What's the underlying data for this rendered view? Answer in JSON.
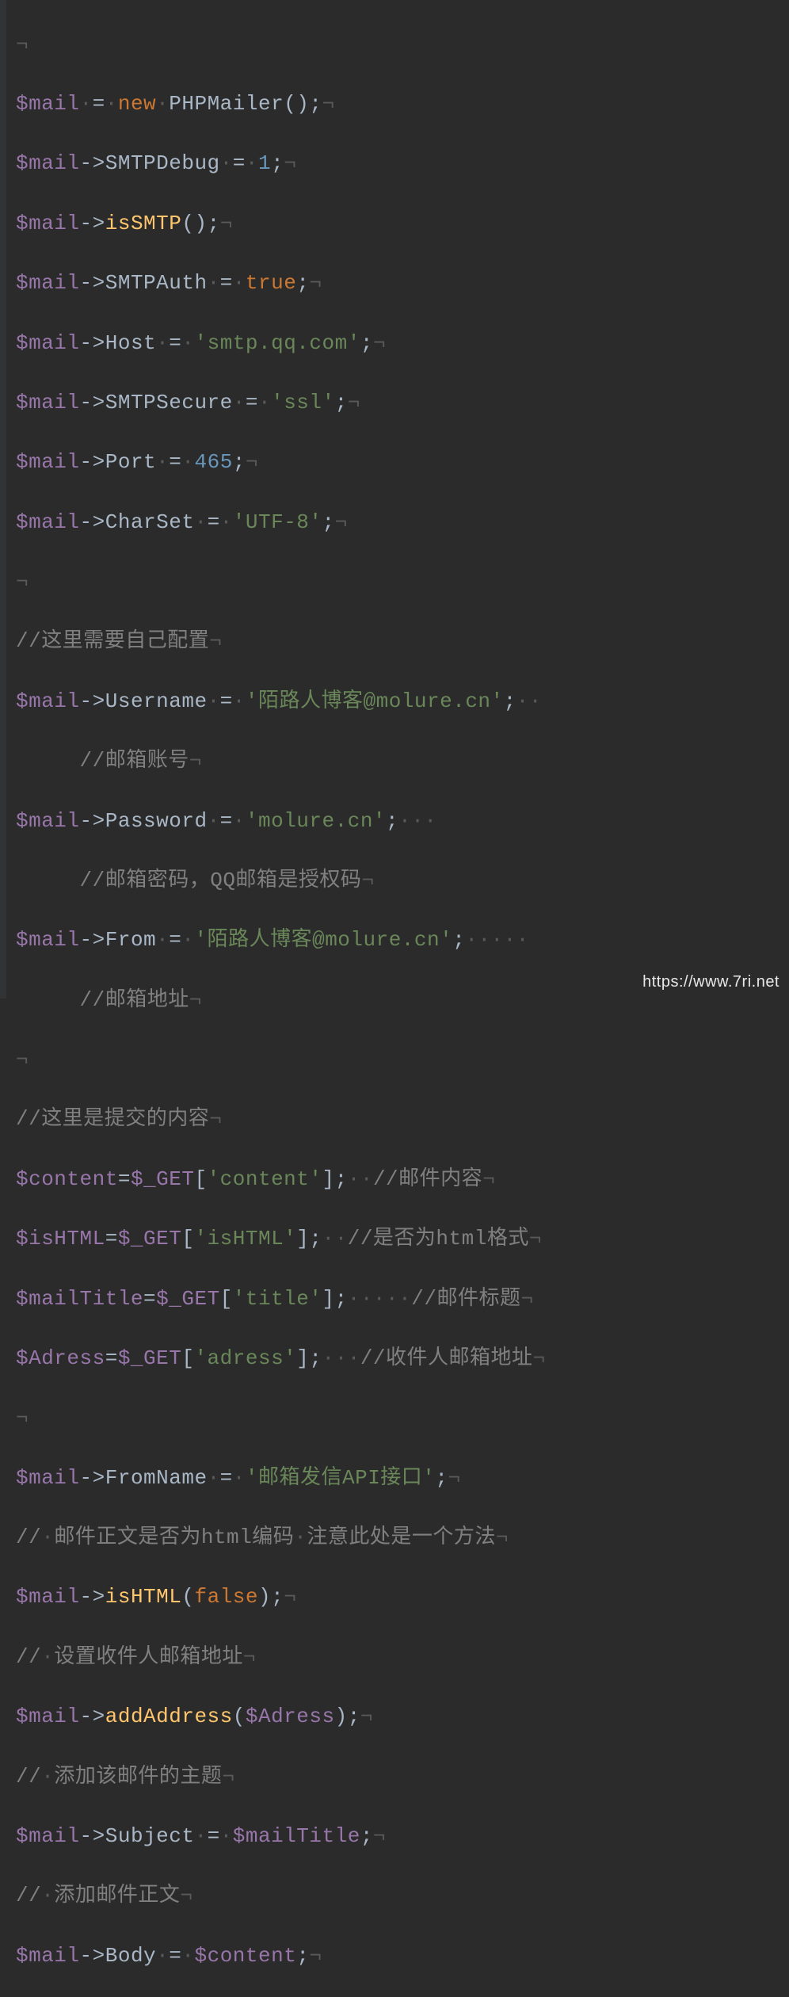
{
  "watermark": "https://www.7ri.net",
  "whitespace": {
    "dot": "·",
    "pilcrow": "¬"
  },
  "code": {
    "l1": {
      "var": "$mail",
      "eq": "=",
      "kw": "new",
      "cls": "PHPMailer",
      "paren": "()",
      "semi": ";"
    },
    "l2": {
      "var": "$mail",
      "arrow": "->",
      "prop": "SMTPDebug",
      "eq": "=",
      "val": "1",
      "semi": ";"
    },
    "l3": {
      "var": "$mail",
      "arrow": "->",
      "func": "isSMTP",
      "paren": "()",
      "semi": ";"
    },
    "l4": {
      "var": "$mail",
      "arrow": "->",
      "prop": "SMTPAuth",
      "eq": "=",
      "val": "true",
      "semi": ";"
    },
    "l5": {
      "var": "$mail",
      "arrow": "->",
      "prop": "Host",
      "eq": "=",
      "str": "'smtp.qq.com'",
      "semi": ";"
    },
    "l6": {
      "var": "$mail",
      "arrow": "->",
      "prop": "SMTPSecure",
      "eq": "=",
      "str": "'ssl'",
      "semi": ";"
    },
    "l7": {
      "var": "$mail",
      "arrow": "->",
      "prop": "Port",
      "eq": "=",
      "val": "465",
      "semi": ";"
    },
    "l8": {
      "var": "$mail",
      "arrow": "->",
      "prop": "CharSet",
      "eq": "=",
      "str": "'UTF-8'",
      "semi": ";"
    },
    "l10": {
      "cmt": "//这里需要自己配置"
    },
    "l11": {
      "var": "$mail",
      "arrow": "->",
      "prop": "Username",
      "eq": "=",
      "str": "'陌路人博客@molure.cn'",
      "semi": ";"
    },
    "l11b": {
      "cmt": "//邮箱账号"
    },
    "l12": {
      "var": "$mail",
      "arrow": "->",
      "prop": "Password",
      "eq": "=",
      "str": "'molure.cn'",
      "semi": ";"
    },
    "l12b": {
      "cmt": "//邮箱密码，QQ邮箱是授权码"
    },
    "l13": {
      "var": "$mail",
      "arrow": "->",
      "prop": "From",
      "eq": "=",
      "str": "'陌路人博客@molure.cn'",
      "semi": ";"
    },
    "l13b": {
      "cmt": "//邮箱地址"
    },
    "l15": {
      "cmt": "//这里是提交的内容"
    },
    "l16": {
      "var": "$content",
      "eq": "=",
      "g": "$_GET",
      "br": "[",
      "str": "'content'",
      "br2": "]",
      "semi": ";",
      "cmt": "//邮件内容"
    },
    "l17": {
      "var": "$isHTML",
      "eq": "=",
      "g": "$_GET",
      "br": "[",
      "str": "'isHTML'",
      "br2": "]",
      "semi": ";",
      "cmt": "//是否为html格式"
    },
    "l18": {
      "var": "$mailTitle",
      "eq": "=",
      "g": "$_GET",
      "br": "[",
      "str": "'title'",
      "br2": "]",
      "semi": ";",
      "cmt": "//邮件标题"
    },
    "l19": {
      "var": "$Adress",
      "eq": "=",
      "g": "$_GET",
      "br": "[",
      "str": "'adress'",
      "br2": "]",
      "semi": ";",
      "cmt": "//收件人邮箱地址"
    },
    "l21": {
      "var": "$mail",
      "arrow": "->",
      "prop": "FromName",
      "eq": "=",
      "str": "'邮箱发信API接口'",
      "semi": ";"
    },
    "l22": {
      "cmt1": "//",
      "txt1": "邮件正文是否为html编码",
      "txt2": "注意此处是一个方法"
    },
    "l23": {
      "var": "$mail",
      "arrow": "->",
      "func": "isHTML",
      "paren1": "(",
      "val": "false",
      "paren2": ")",
      "semi": ";"
    },
    "l24": {
      "cmt1": "//",
      "txt": "设置收件人邮箱地址"
    },
    "l25": {
      "var": "$mail",
      "arrow": "->",
      "func": "addAddress",
      "paren1": "(",
      "arg": "$Adress",
      "paren2": ")",
      "semi": ";"
    },
    "l26": {
      "cmt1": "//",
      "txt": "添加该邮件的主题"
    },
    "l27": {
      "var": "$mail",
      "arrow": "->",
      "prop": "Subject",
      "eq": "=",
      "val": "$mailTitle",
      "semi": ";"
    },
    "l28": {
      "cmt1": "//",
      "txt": "添加邮件正文"
    },
    "l29": {
      "var": "$mail",
      "arrow": "->",
      "prop": "Body",
      "eq": "=",
      "val": "$content",
      "semi": ";"
    }
  }
}
